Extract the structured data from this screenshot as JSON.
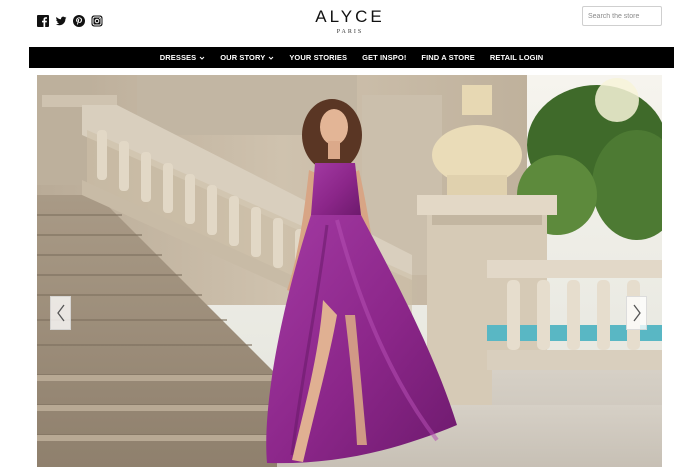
{
  "header": {
    "social": [
      {
        "icon": "facebook-icon"
      },
      {
        "icon": "twitter-icon"
      },
      {
        "icon": "pinterest-icon"
      },
      {
        "icon": "instagram-icon"
      }
    ],
    "logo": {
      "brand": "ALYCE",
      "sub": "PARIS"
    },
    "search": {
      "placeholder": "Search the store",
      "value": ""
    }
  },
  "nav": {
    "items": [
      {
        "label": "DRESSES",
        "has_dropdown": true
      },
      {
        "label": "OUR STORY",
        "has_dropdown": true
      },
      {
        "label": "YOUR STORIES",
        "has_dropdown": false
      },
      {
        "label": "GET INSPO!",
        "has_dropdown": false
      },
      {
        "label": "FIND A STORE",
        "has_dropdown": false
      },
      {
        "label": "RETAIL LOGIN",
        "has_dropdown": false
      }
    ]
  },
  "hero": {
    "prev_icon": "chevron-left-icon",
    "next_icon": "chevron-right-icon",
    "colors": {
      "dress": "#8e2a8e",
      "stone": "#c9bca9",
      "sky": "#eef2ef",
      "foliage": "#3f6a2a"
    }
  }
}
